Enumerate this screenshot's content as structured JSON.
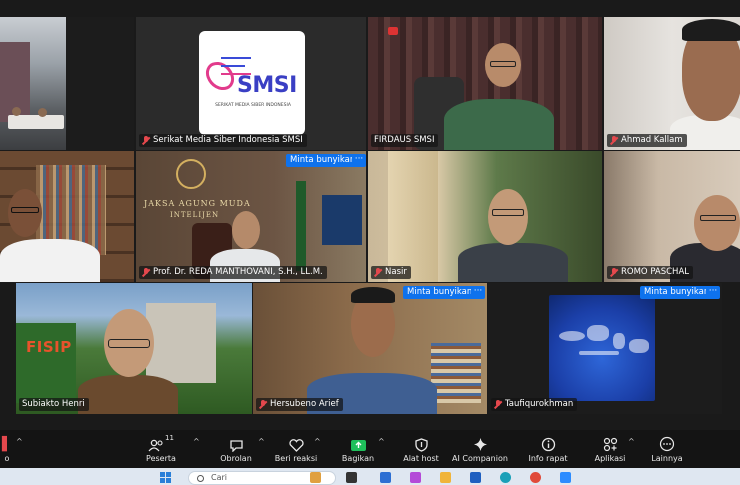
{
  "tiles": [
    {
      "id": "t1",
      "name": "",
      "muted": false,
      "ask_unmute": false
    },
    {
      "id": "t2",
      "name": "Serikat Media Siber Indonesia SMSI",
      "muted": true,
      "ask_unmute": false
    },
    {
      "id": "t3",
      "name": "FIRDAUS SMSI",
      "muted": false,
      "ask_unmute": false
    },
    {
      "id": "t4",
      "name": "Ahmad Kallam",
      "muted": true,
      "ask_unmute": false
    },
    {
      "id": "t5",
      "name": "",
      "muted": false,
      "ask_unmute": false
    },
    {
      "id": "t6",
      "name": "Prof. Dr. REDA MANTHOVANI, S.H., LL.M.",
      "muted": true,
      "ask_unmute": true
    },
    {
      "id": "t7",
      "name": "Nasir",
      "muted": true,
      "ask_unmute": false
    },
    {
      "id": "t8",
      "name": "ROMO PASCHAL",
      "muted": true,
      "ask_unmute": false
    },
    {
      "id": "t9",
      "name": "Subiakto Henri",
      "muted": false,
      "ask_unmute": false
    },
    {
      "id": "t10",
      "name": "Hersubeno Arief",
      "muted": true,
      "ask_unmute": true
    },
    {
      "id": "t11",
      "name": "Taufiqurokhman",
      "muted": true,
      "ask_unmute": true
    }
  ],
  "ask_unmute_label": "Minta bunyikan",
  "more_label": "···",
  "logo": {
    "text": "SMSI",
    "subtitle": "SERIKAT MEDIA SIBER INDONESIA"
  },
  "wall_text": {
    "line1": "JAKSA AGUNG MUDA",
    "line2": "INTELIJEN"
  },
  "fisip": "FISIP",
  "toolbar": {
    "partial_label": "o",
    "participants_label": "Peserta",
    "participants_count": "11",
    "chat_label": "Obrolan",
    "reactions_label": "Beri reaksi",
    "share_label": "Bagikan",
    "host_tools_label": "Alat host",
    "ai_label": "AI Companion",
    "info_label": "Info rapat",
    "apps_label": "Aplikasi",
    "more_label": "Lainnya"
  },
  "taskbar": {
    "search_placeholder": "Cari"
  },
  "colors": {
    "accent": "#0e72ed",
    "muted": "#e5484d",
    "active_speaker": "#2ecc71",
    "share_green": "#1fbf5b"
  }
}
